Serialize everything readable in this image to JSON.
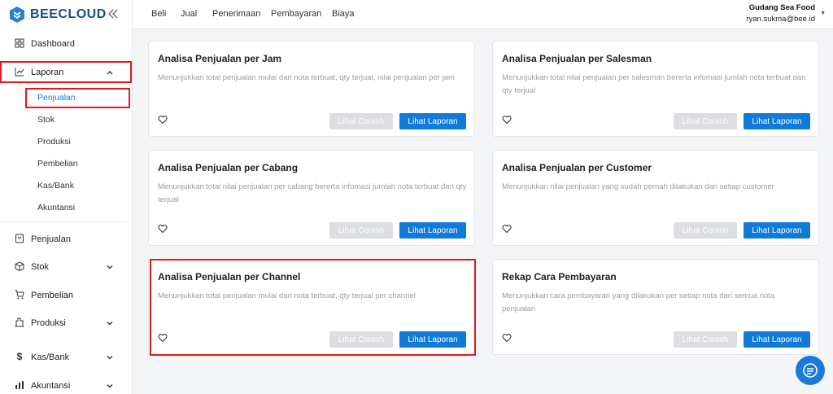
{
  "brand": {
    "name": "BEECLOUD"
  },
  "topbar": {
    "tabs": [
      "Beli",
      "Jual",
      "Penerimaan",
      "Pembayaran",
      "Biaya"
    ],
    "company": "Gudang Sea Food",
    "email": "ryan.sukma@bee.id"
  },
  "sidebar": {
    "dashboard": "Dashboard",
    "laporan": "Laporan",
    "laporan_sub": [
      "Penjualan",
      "Stok",
      "Produksi",
      "Pembelian",
      "Kas/Bank",
      "Akuntansi"
    ],
    "penjualan": "Penjualan",
    "stok": "Stok",
    "pembelian": "Pembelian",
    "produksi": "Produksi",
    "kasbank": "Kas/Bank",
    "akuntansi": "Akuntansi"
  },
  "buttons": {
    "contoh": "Lihat Contoh",
    "laporan": "Lihat Laporan"
  },
  "cards": [
    {
      "title": "Analisa Penjualan per Jam",
      "desc": "Menunjukkan total penjualan mulai dari nota terbuat, qty terjual, nilai penjualan per jam"
    },
    {
      "title": "Analisa Penjualan per Salesman",
      "desc": "Menunjukkan total nilai penjualan per salesman bererta infomasi jumlah nota terbuat dan qty terjual"
    },
    {
      "title": "Analisa Penjualan per Cabang",
      "desc": "Menunjukkan total nilai penjualan per cabang bererta infomasi jumlah nota terbuat dan qty terjual"
    },
    {
      "title": "Analisa Penjualan per Customer",
      "desc": "Menunjukkan nilai penjualan yang sudah pernah dilakukan dari setiap customer"
    },
    {
      "title": "Analisa Penjualan per Channel",
      "desc": "Menunjukkan total penjualan mulai dari nota terbuat, qty terjual per channel"
    },
    {
      "title": "Rekap Cara Pembayaran",
      "desc": "Menunjukkan cara pembayaran yang dilakukan per setiap nota dari semua nota penjualan"
    }
  ],
  "colors": {
    "accent": "#0f7ad8",
    "highlight": "#e01b1b",
    "brand": "#1b4d8c"
  }
}
